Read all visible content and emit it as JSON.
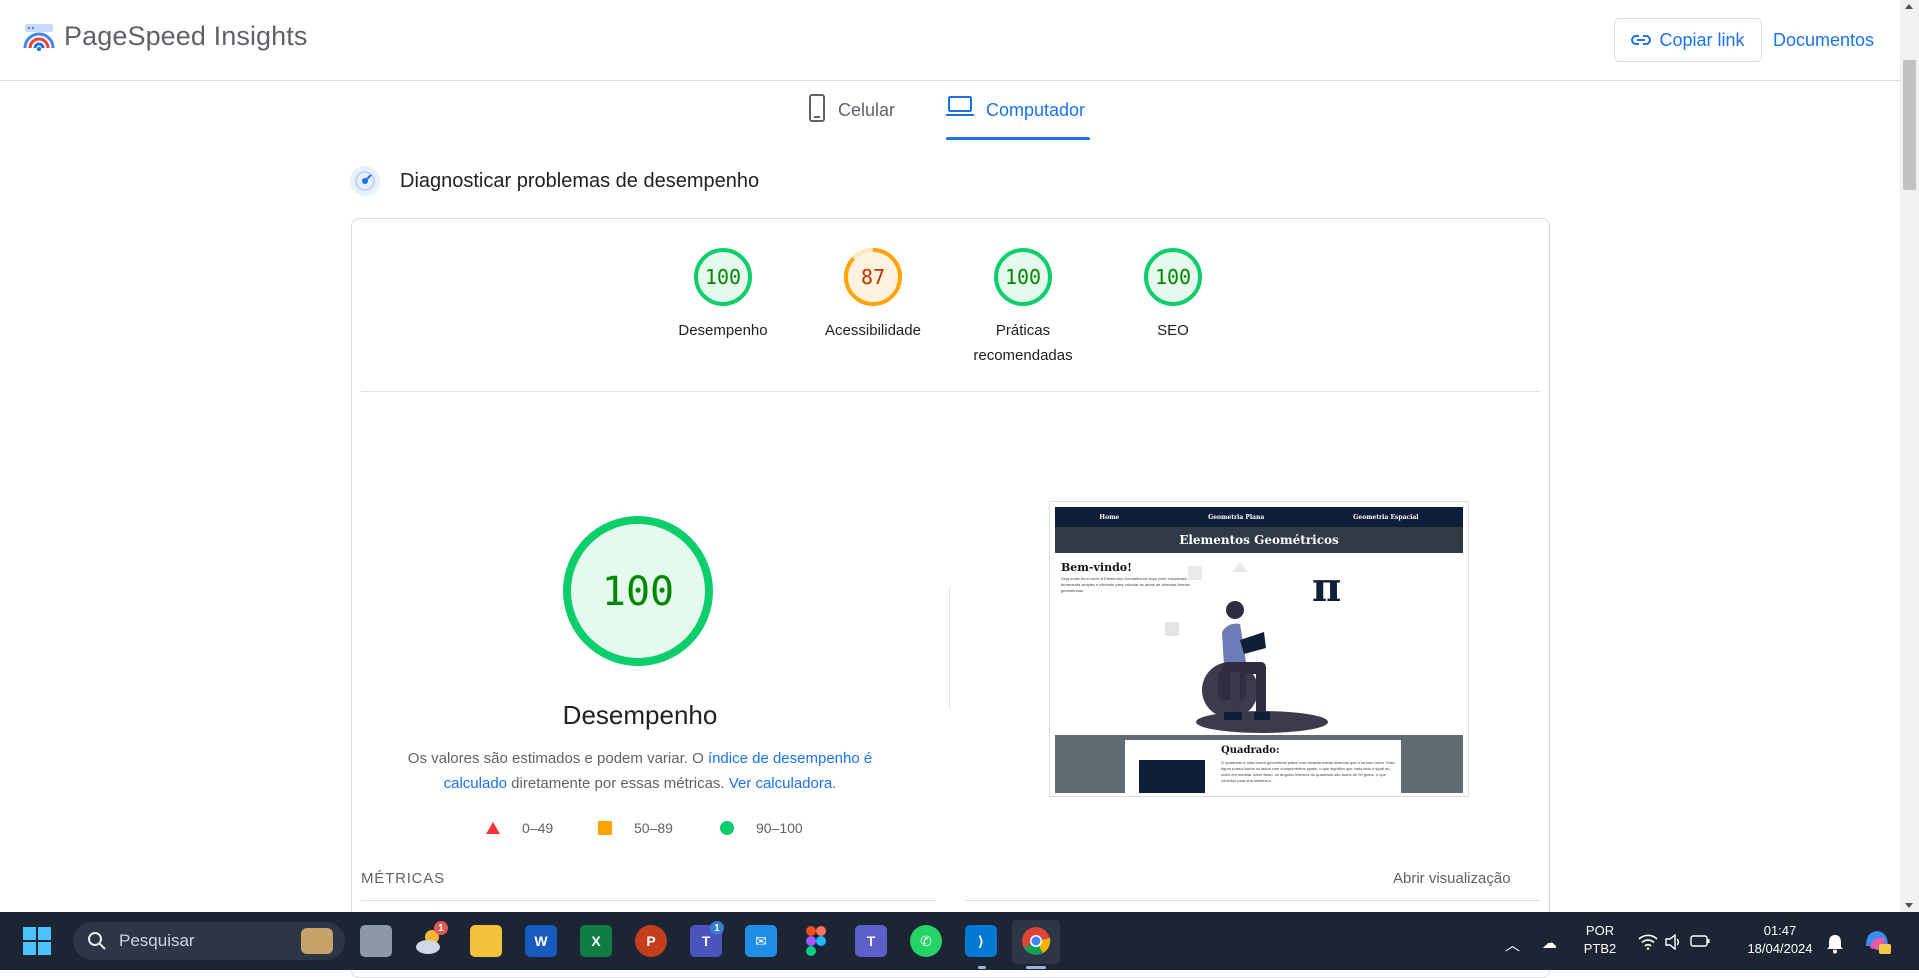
{
  "header": {
    "brand": "PageSpeed Insights",
    "copy_link": "Copiar link",
    "docs": "Documentos"
  },
  "tabs": {
    "mobile": "Celular",
    "desktop": "Computador",
    "active": "Computador"
  },
  "diagnose": {
    "title": "Diagnosticar problemas de desempenho"
  },
  "scores": [
    {
      "label_line1": "Desempenho",
      "label_line2": "",
      "value": "100",
      "color": "#0cce6b"
    },
    {
      "label_line1": "Acessibilidade",
      "label_line2": "",
      "value": "87",
      "color": "#ffa400"
    },
    {
      "label_line1": "Práticas",
      "label_line2": "recomendadas",
      "value": "100",
      "color": "#0cce6b"
    },
    {
      "label_line1": "SEO",
      "label_line2": "",
      "value": "100",
      "color": "#0cce6b"
    }
  ],
  "performance": {
    "score": "100",
    "title": "Desempenho",
    "desc_prefix": "Os valores são estimados e podem variar. O ",
    "desc_link1": "índice de desempenho é calculado",
    "desc_middle": " diretamente por essas métricas. ",
    "desc_link2": "Ver calculadora",
    "desc_suffix": "."
  },
  "legend": {
    "poor": "0–49",
    "average": "50–89",
    "good": "90–100"
  },
  "metrics": {
    "label": "MÉTRICAS",
    "open_view": "Abrir visualização"
  },
  "preview": {
    "nav": [
      "Home",
      "Geometria Plana",
      "Geometria Espacial"
    ],
    "title": "Elementos Geométricos",
    "welcome": "Bem-vindo!",
    "welcome_text": "Seja muito bem-vindo à Elementos Geométricos! Aqui você encontrará uma ferramenta simples e eficiente para calcular as áreas de diversas formas geométricas.",
    "pi": "π",
    "section_title": "Quadrado:",
    "section_text": "O quadrado é uma forma geométrica plana com características distintas que o tornam único. Esta figura possui todos os lados com comprimentos iguais, o que significa que cada lado é igual ao outro em medida. Além disso, os ângulos internos do quadrado são todos de 90 graus, o que contribui para sua simetria e"
  },
  "taskbar": {
    "search": "Pesquisar",
    "lang_line1": "POR",
    "lang_line2": "PTB2",
    "time": "01:47",
    "date": "18/04/2024",
    "weather_badge": "1",
    "teams_badge": "1"
  }
}
